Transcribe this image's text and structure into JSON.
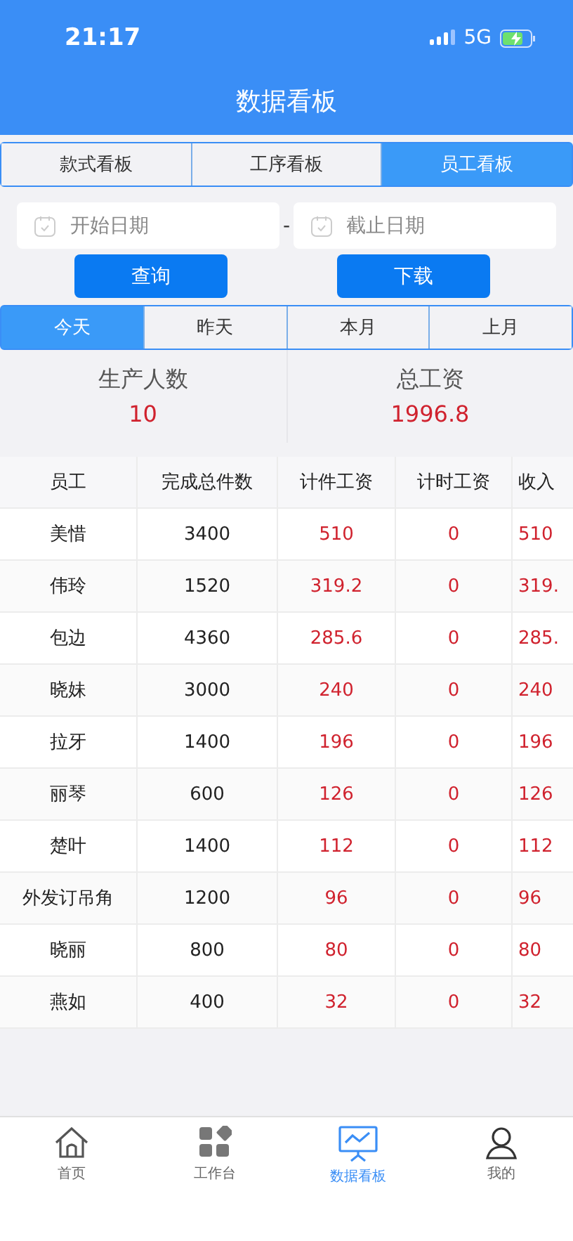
{
  "status_bar": {
    "time": "21:17",
    "network": "5G"
  },
  "header": {
    "title": "数据看板"
  },
  "board_tabs": [
    {
      "label": "款式看板",
      "selected": false
    },
    {
      "label": "工序看板",
      "selected": false
    },
    {
      "label": "员工看板",
      "selected": true
    }
  ],
  "date_range": {
    "start": {
      "placeholder": "开始日期"
    },
    "separator": "-",
    "end": {
      "placeholder": "截止日期"
    }
  },
  "buttons": [
    "查询",
    "下载"
  ],
  "period_tabs": [
    {
      "label": "今天",
      "selected": true
    },
    {
      "label": "昨天",
      "selected": false
    },
    {
      "label": "本月",
      "selected": false
    },
    {
      "label": "上月",
      "selected": false
    }
  ],
  "summary": [
    {
      "label": "生产人数",
      "value": "10"
    },
    {
      "label": "总工资",
      "value": "1996.8"
    }
  ],
  "table": {
    "columns": [
      "员工",
      "完成总件数",
      "计件工资",
      "计时工资",
      "收入"
    ],
    "rows": [
      [
        "美惜",
        "3400",
        "510",
        "0",
        "510"
      ],
      [
        "伟玲",
        "1520",
        "319.2",
        "0",
        "319."
      ],
      [
        "包边",
        "4360",
        "285.6",
        "0",
        "285."
      ],
      [
        "晓妹",
        "3000",
        "240",
        "0",
        "240"
      ],
      [
        "拉牙",
        "1400",
        "196",
        "0",
        "196"
      ],
      [
        "丽琴",
        "600",
        "126",
        "0",
        "126"
      ],
      [
        "楚叶",
        "1400",
        "112",
        "0",
        "112"
      ],
      [
        "外发订吊角",
        "1200",
        "96",
        "0",
        "96"
      ],
      [
        "晓丽",
        "800",
        "80",
        "0",
        "80"
      ],
      [
        "燕如",
        "400",
        "32",
        "0",
        "32"
      ]
    ]
  },
  "tab_bar": [
    {
      "label": "首页",
      "kind": "home",
      "selected": false
    },
    {
      "label": "工作台",
      "kind": "apps",
      "selected": false
    },
    {
      "label": "数据看板",
      "kind": "chart",
      "selected": true
    },
    {
      "label": "我的",
      "kind": "user",
      "selected": false
    }
  ]
}
